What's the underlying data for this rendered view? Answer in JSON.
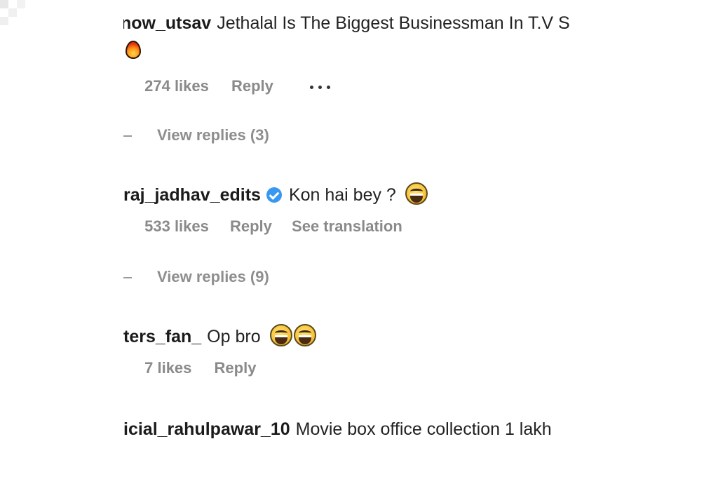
{
  "comments": [
    {
      "username": "now_utsav",
      "text": "Jethalal Is The Biggest Businessman In T.V S",
      "emoji": "fire-emoji",
      "likes": "274 likes",
      "reply": "Reply",
      "more": "•••",
      "view_replies": "View replies (3)"
    },
    {
      "username": "raj_jadhav_edits",
      "verified": true,
      "text": "Kon hai bey ?",
      "emoji": "laughing-emoji",
      "likes": "533 likes",
      "reply": "Reply",
      "translation": "See translation",
      "view_replies": "View replies (9)"
    },
    {
      "username": "ters_fan_",
      "text": "Op bro",
      "emoji": "laughing-emoji",
      "likes": "7 likes",
      "reply": "Reply"
    },
    {
      "username": "icial_rahulpawar_10",
      "text": "Movie box office collection 1 lakh"
    }
  ],
  "colors": {
    "verified_badge": "#3897f0",
    "meta_text": "#8a8a8a",
    "body_text": "#1d1d1d"
  }
}
